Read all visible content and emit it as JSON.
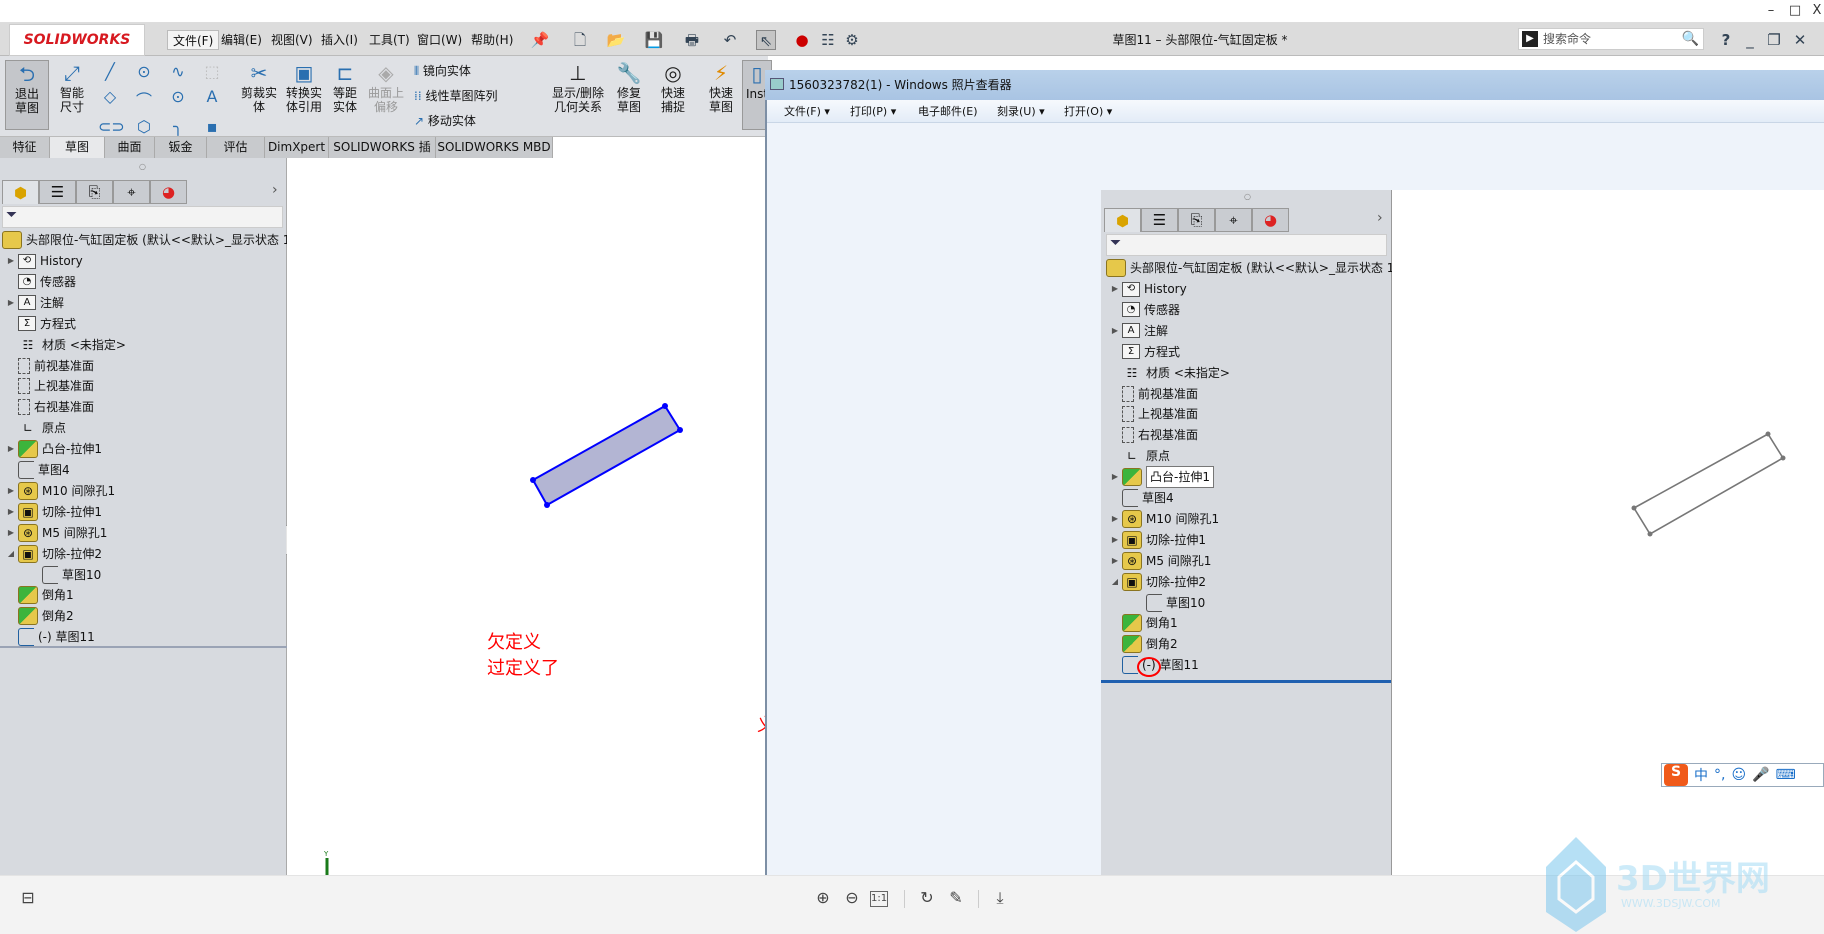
{
  "window_controls": {
    "minimize": "–",
    "maximize": "□",
    "close": "X"
  },
  "solidworks": {
    "logo": "SOLIDWORKS",
    "menus": [
      "文件(F)",
      "编辑(E)",
      "视图(V)",
      "插入(I)",
      "工具(T)",
      "窗口(W)",
      "帮助(H)"
    ],
    "doc_title": "草图11 – 头部限位-气缸固定板 *",
    "search_placeholder": "搜索命令",
    "help": "?",
    "ribbon": {
      "exit_sketch": "退出草图",
      "smart_dim": "智能尺寸",
      "trim": "剪裁实体",
      "convert": "转换实体引用",
      "offset": "等距实体",
      "surface_offset": "曲面上偏移",
      "mirror": "镜向实体",
      "linear_pattern": "线性草图阵列",
      "move": "移动实体",
      "relations": "显示/删除几何关系",
      "repair": "修复草图",
      "quick_snap": "快速捕捉",
      "rapid_sketch": "快速草图",
      "instant": "Inst"
    },
    "tabs": [
      "特征",
      "草图",
      "曲面",
      "钣金",
      "评估",
      "DimXpert",
      "SOLIDWORKS 插件",
      "SOLIDWORKS MBD"
    ],
    "active_tab": "草图"
  },
  "tree": {
    "root": "头部限位-气缸固定板  (默认<<默认>_显示状态 1>)",
    "items": [
      {
        "label": "History",
        "icon": "history-folder",
        "exp": "collapsed",
        "indent": 0
      },
      {
        "label": "传感器",
        "icon": "sensor-folder",
        "exp": "none",
        "indent": 0
      },
      {
        "label": "注解",
        "icon": "annotation-folder",
        "exp": "collapsed",
        "indent": 0
      },
      {
        "label": "方程式",
        "icon": "equation-folder",
        "exp": "none",
        "indent": 0
      },
      {
        "label": "材质 <未指定>",
        "icon": "material",
        "exp": "none",
        "indent": 0
      },
      {
        "label": "前视基准面",
        "icon": "plane",
        "exp": "none",
        "indent": 0
      },
      {
        "label": "上视基准面",
        "icon": "plane",
        "exp": "none",
        "indent": 0
      },
      {
        "label": "右视基准面",
        "icon": "plane",
        "exp": "none",
        "indent": 0
      },
      {
        "label": "原点",
        "icon": "origin",
        "exp": "none",
        "indent": 0
      },
      {
        "label": "凸台-拉伸1",
        "icon": "boss-extrude",
        "exp": "collapsed",
        "indent": 0
      },
      {
        "label": "草图4",
        "icon": "sketch",
        "exp": "none",
        "indent": 0
      },
      {
        "label": "M10 间隙孔1",
        "icon": "hole",
        "exp": "collapsed",
        "indent": 0
      },
      {
        "label": "切除-拉伸1",
        "icon": "cut-extrude",
        "exp": "collapsed",
        "indent": 0
      },
      {
        "label": "M5 间隙孔1",
        "icon": "hole",
        "exp": "collapsed",
        "indent": 0
      },
      {
        "label": "切除-拉伸2",
        "icon": "cut-extrude",
        "exp": "expanded",
        "indent": 0
      },
      {
        "label": "草图10",
        "icon": "sketch",
        "exp": "none",
        "indent": 1
      },
      {
        "label": "倒角1",
        "icon": "chamfer",
        "exp": "none",
        "indent": 0
      },
      {
        "label": "倒角2",
        "icon": "chamfer",
        "exp": "none",
        "indent": 0
      },
      {
        "label": "(-) 草图11",
        "icon": "sketch-active",
        "exp": "none",
        "indent": 0
      }
    ]
  },
  "canvas_notes": [
    "欠定义",
    "过定义了"
  ],
  "canvas_fragment": "义",
  "viewer": {
    "title": "1560323782(1) - Windows 照片查看器",
    "menus": [
      {
        "label": "文件(F)",
        "arrow": "▾"
      },
      {
        "label": "打印(P)",
        "arrow": "▾"
      },
      {
        "label": "电子邮件(E)",
        "arrow": ""
      },
      {
        "label": "刻录(U)",
        "arrow": "▾"
      },
      {
        "label": "打开(O)",
        "arrow": "▾"
      }
    ],
    "ime": [
      "S",
      "中",
      "°,",
      "☺",
      "🎤",
      "⌨"
    ]
  },
  "watermark": {
    "brand": "3D世界网",
    "url": "WWW.3DSJW.COM"
  },
  "colors": {
    "sketch_blue": "#0000ff",
    "sketch_fill": "#b3b5d3",
    "note_red": "#ff0000",
    "highlight_circle": "#ff0000"
  }
}
